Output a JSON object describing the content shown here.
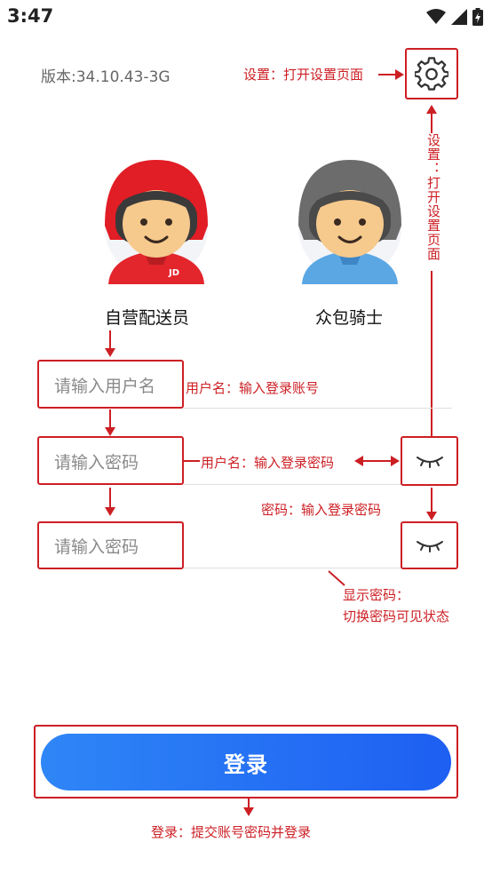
{
  "status_bar": {
    "time": "3:47"
  },
  "header": {
    "version": "版本:34.10.43-3G"
  },
  "roles": [
    {
      "label": "自营配送员"
    },
    {
      "label": "众包骑士"
    }
  ],
  "form": {
    "username_placeholder": "请输入用户名",
    "password_placeholder": "请输入密码",
    "password_confirm_placeholder": "请输入密码"
  },
  "login": {
    "label": "登录"
  },
  "annotations": {
    "settings": "设置：打开设置页面",
    "settings_vertical": "设置：打开设置页面",
    "username": "用户名：输入登录账号",
    "password": "用户名：输入登录密码",
    "password2": "密码：输入登录密码",
    "show_password_line1": "显示密码：",
    "show_password_line2": "切换密码可见状态",
    "login": "登录：提交账号密码并登录"
  },
  "colors": {
    "annotation_red": "#cc1f24",
    "button_blue": "#1d66f4"
  }
}
